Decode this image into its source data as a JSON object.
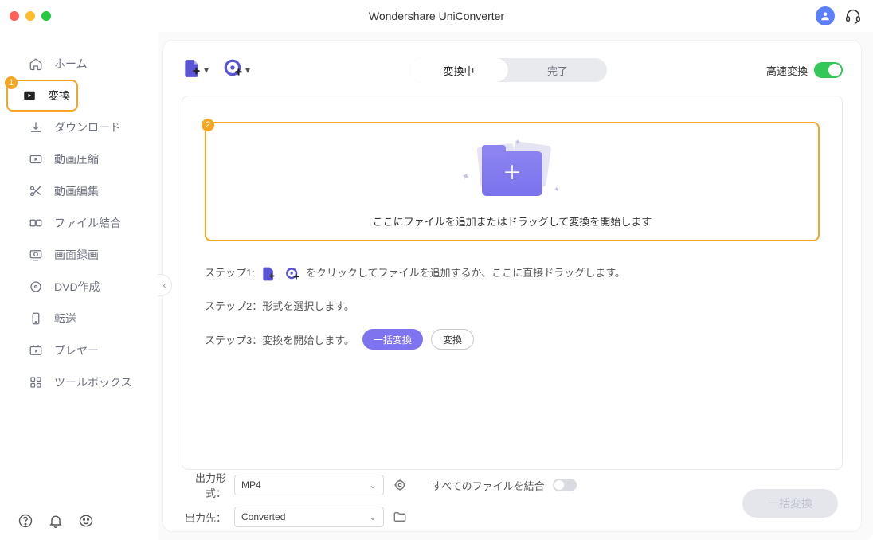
{
  "app": {
    "title": "Wondershare UniConverter"
  },
  "badges": {
    "sidebar_active": "1",
    "dropzone": "2"
  },
  "sidebar": {
    "items": [
      {
        "label": "ホーム"
      },
      {
        "label": "変換"
      },
      {
        "label": "ダウンロード"
      },
      {
        "label": "動画圧縮"
      },
      {
        "label": "動画編集"
      },
      {
        "label": "ファイル結合"
      },
      {
        "label": "画面録画"
      },
      {
        "label": "DVD作成"
      },
      {
        "label": "転送"
      },
      {
        "label": "プレヤー"
      },
      {
        "label": "ツールボックス"
      }
    ]
  },
  "tabs": {
    "converting": "変換中",
    "done": "完了"
  },
  "highspeed_label": "高速変換",
  "dropzone_text": "ここにファイルを追加またはドラッグして変換を開始します",
  "steps": {
    "s1_prefix": "ステップ1:",
    "s1_suffix": "をクリックしてファイルを追加するか、ここに直接ドラッグします。",
    "s2": "ステップ2：形式を選択します。",
    "s3": "ステップ3：変換を開始します。",
    "batch_btn": "一括変換",
    "convert_btn": "変換"
  },
  "bottom": {
    "format_label": "出力形式：",
    "format_value": "MP4",
    "dest_label": "出力先：",
    "dest_value": "Converted",
    "merge_label": "すべてのファイルを結合",
    "big_convert": "一括変換"
  },
  "colors": {
    "accent": "#7e74f0",
    "warn": "#f5a623"
  }
}
